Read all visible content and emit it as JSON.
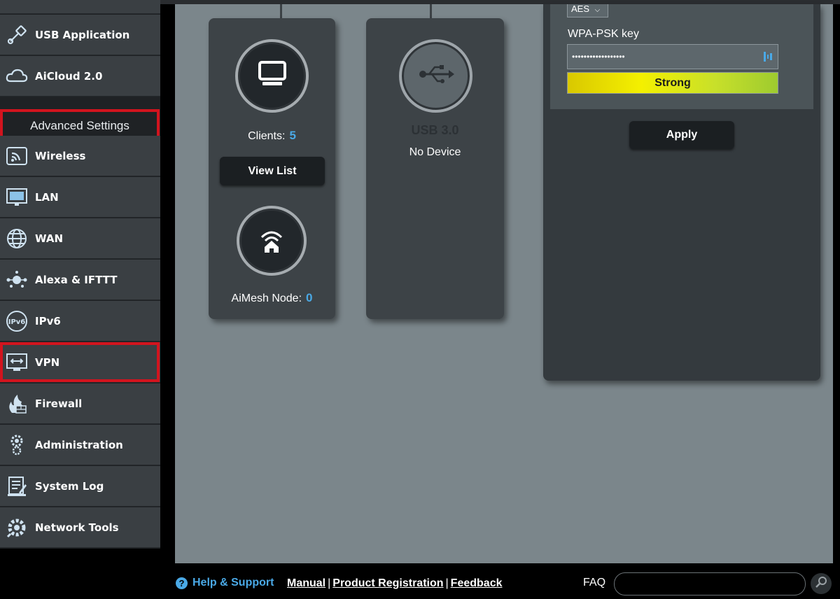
{
  "sidebar": {
    "items": [
      {
        "label": "USB Application",
        "icon": "usb-application-icon"
      },
      {
        "label": "AiCloud 2.0",
        "icon": "aicloud-icon"
      },
      {
        "label": "Wireless",
        "icon": "wireless-icon"
      },
      {
        "label": "LAN",
        "icon": "lan-icon"
      },
      {
        "label": "WAN",
        "icon": "wan-globe-icon"
      },
      {
        "label": "Alexa & IFTTT",
        "icon": "alexa-icon"
      },
      {
        "label": "IPv6",
        "icon": "ipv6-icon"
      },
      {
        "label": "VPN",
        "icon": "vpn-icon"
      },
      {
        "label": "Firewall",
        "icon": "firewall-icon"
      },
      {
        "label": "Administration",
        "icon": "administration-icon"
      },
      {
        "label": "System Log",
        "icon": "system-log-icon"
      },
      {
        "label": "Network Tools",
        "icon": "network-tools-icon"
      }
    ],
    "section_header": "Advanced Settings",
    "highlight_color": "#d2141e"
  },
  "clients_card": {
    "clients_label": "Clients:",
    "clients_count": "5",
    "view_list_label": "View List",
    "aimesh_label": "AiMesh Node:",
    "aimesh_count": "0"
  },
  "usb_card": {
    "title": "USB 3.0",
    "status": "No Device"
  },
  "wireless_panel": {
    "encryption_value": "AES",
    "wpa_label": "WPA-PSK key",
    "wpa_value": "••••••••••••••••••",
    "strength_label": "Strong",
    "apply_label": "Apply"
  },
  "footer": {
    "help_label": "Help & Support",
    "links": [
      "Manual",
      "Product Registration",
      "Feedback"
    ],
    "faq_label": "FAQ",
    "faq_placeholder": ""
  },
  "colors": {
    "accent": "#4aa9e6",
    "sidebar_bg": "#3a3f43",
    "main_bg": "#7b868b"
  }
}
